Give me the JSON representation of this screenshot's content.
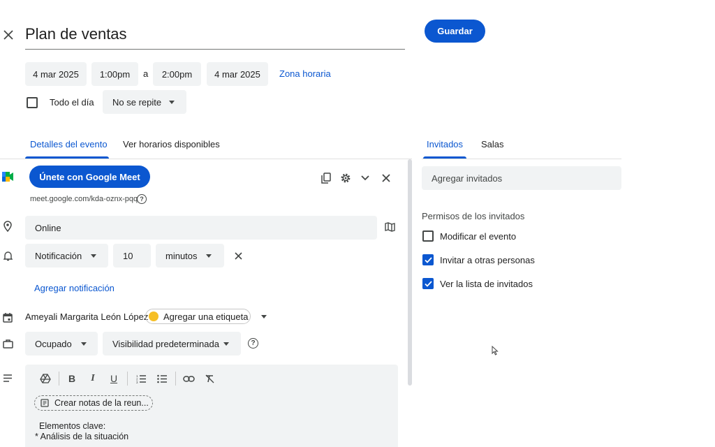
{
  "header": {
    "title": "Plan de ventas",
    "save_label": "Guardar"
  },
  "datetime": {
    "start_date": "4 mar 2025",
    "start_time": "1:00pm",
    "to_label": "a",
    "end_time": "2:00pm",
    "end_date": "4 mar 2025",
    "timezone_label": "Zona horaria",
    "all_day_label": "Todo el día",
    "all_day_checked": false,
    "repeat_value": "No se repite"
  },
  "tabs": {
    "details": "Detalles del evento",
    "find_time": "Ver horarios disponibles",
    "guests": "Invitados",
    "rooms": "Salas",
    "active_left": "details",
    "active_right": "guests"
  },
  "meet": {
    "button_label": "Únete con Google Meet",
    "url": "meet.google.com/kda-oznx-pqq"
  },
  "location": {
    "value": "Online"
  },
  "notification": {
    "type": "Notificación",
    "amount": "10",
    "unit": "minutos",
    "add_label": "Agregar notificación"
  },
  "calendar": {
    "owner": "Ameyali Margarita León López",
    "label_button": "Agregar una etiqueta",
    "label_color": "#f6bf26"
  },
  "status": {
    "busy": "Ocupado",
    "visibility": "Visibilidad predeterminada"
  },
  "description": {
    "notes_chip": "Crear notas de la reun...",
    "line1": "Elementos clave:",
    "line2": "*  Análisis de la situación"
  },
  "guests": {
    "add_placeholder": "Agregar invitados",
    "permissions_title": "Permisos de los invitados",
    "permissions": [
      {
        "label": "Modificar el evento",
        "checked": false
      },
      {
        "label": "Invitar a otras personas",
        "checked": true
      },
      {
        "label": "Ver la lista de invitados",
        "checked": true
      }
    ]
  },
  "colors": {
    "accent": "#0b57d0",
    "chip_bg": "#f1f3f4",
    "text": "#1f1f1f"
  }
}
